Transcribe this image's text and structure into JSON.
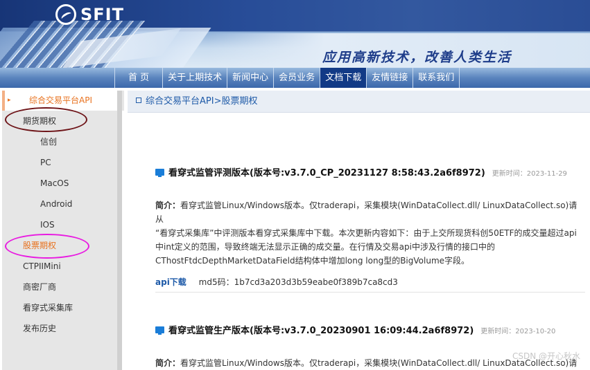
{
  "header": {
    "logo_text": "SFIT",
    "slogan": "应用高新技术，改善人类生活"
  },
  "nav": {
    "items": [
      {
        "label": "首 页"
      },
      {
        "label": "关于上期技术"
      },
      {
        "label": "新闻中心"
      },
      {
        "label": "会员业务"
      },
      {
        "label": "文档下载",
        "active": true
      },
      {
        "label": "友情链接"
      },
      {
        "label": "联系我们"
      }
    ]
  },
  "sidebar": {
    "header": "综合交易平台API",
    "items": [
      {
        "label": "期货期权"
      },
      {
        "label": "信创"
      },
      {
        "label": "PC"
      },
      {
        "label": "MacOS"
      },
      {
        "label": "Android"
      },
      {
        "label": "IOS"
      },
      {
        "label": "股票期权",
        "current": true
      },
      {
        "label": "CTPIIMini"
      },
      {
        "label": "商密厂商"
      },
      {
        "label": "看穿式采集库"
      },
      {
        "label": "发布历史"
      }
    ]
  },
  "main": {
    "breadcrumb": "综合交易平台API>股票期权",
    "entries": [
      {
        "title": "看穿式监管评测版本(版本号:v3.7.0_CP_20231127 8:58:43.2a6f8972)",
        "updated_label": "更新时间：",
        "updated": "2023-11-29",
        "desc_label": "简介：",
        "desc_line1": "看穿式监管Linux/Windows版本。仅traderapi，采集模块(WinDataCollect.dll/ LinuxDataCollect.so)请从",
        "desc_line2": "“看穿式采集库”中评测版本看穿式采集库中下载。本次更新内容如下：由于上交所现货科创50ETF的成交量超过api",
        "desc_line3": "中int定义的范围，导致终端无法显示正确的成交量。在行情及交易api中涉及行情的接口中的",
        "desc_line4": "CThostFtdcDepthMarketDataField结构体中增加long long型的BigVolume字段。",
        "download_label": "api下载",
        "md5": "md5码：1b7cd3a203d3b59eabe0f389b7ca8cd3"
      },
      {
        "title": "看穿式监管生产版本(版本号:v3.7.0_20230901 16:09:44.2a6f8972)",
        "updated_label": "更新时间：",
        "updated": "2023-10-20",
        "desc_label": "简介：",
        "desc_line1": "看穿式监管Linux/Windows版本。仅traderapi，采集模块(WinDataCollect.dll/ LinuxDataCollect.so)请从"
      }
    ]
  },
  "watermark": "CSDN @开心秋水"
}
